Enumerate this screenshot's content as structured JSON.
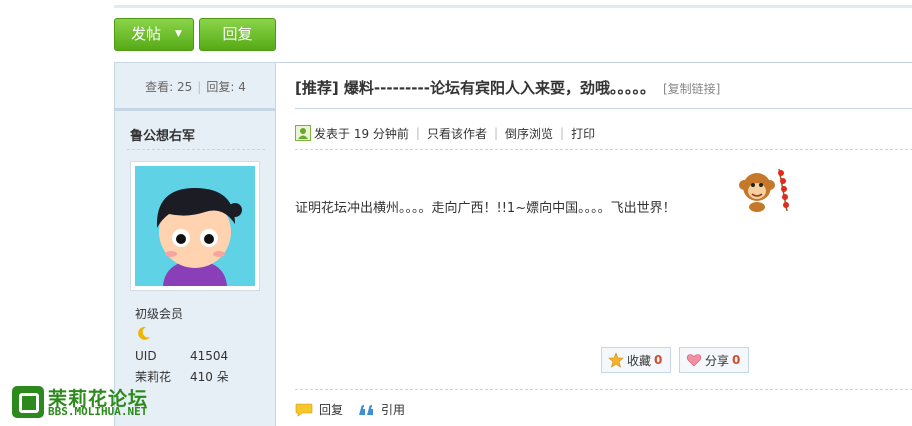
{
  "toolbar": {
    "post_label": "发帖",
    "reply_label": "回复"
  },
  "stats": {
    "views_label": "查看:",
    "views": "25",
    "replies_label": "回复:",
    "replies": "4"
  },
  "author": {
    "name": "鲁公想右军",
    "rank": "初级会员",
    "rows": [
      {
        "key": "UID",
        "value": "41504"
      },
      {
        "key": "茉莉花",
        "value": "410 朵"
      }
    ]
  },
  "thread": {
    "title": "[推荐] 爆料---------论坛有宾阳人入来耍，劲哦。。。。。",
    "copy_link": "[复制链接]"
  },
  "meta": {
    "posted": "发表于 19 分钟前",
    "only_author": "只看该作者",
    "reverse": "倒序浏览",
    "print": "打印"
  },
  "post": {
    "content": "证明花坛冲出横州。。。。走向广西！!!1~嫖向中国。。。。飞出世界！"
  },
  "actions": {
    "favorite_label": "收藏",
    "favorite_count": "0",
    "share_label": "分享",
    "share_count": "0"
  },
  "footer": {
    "reply_label": "回复",
    "quote_label": "引用"
  },
  "logo": {
    "cn": "茉莉花论坛",
    "en": "BBS.MOLIHUA.NET"
  },
  "colors": {
    "accent_green": "#56aa16",
    "border": "#c7d6e5",
    "side_bg": "#e6eef6",
    "count_red": "#d24d2f"
  },
  "icons": [
    "caret-down-icon",
    "moon-icon",
    "user-icon",
    "monkey-emoticon",
    "star-icon",
    "heart-icon",
    "reply-bubble-icon",
    "quote-icon"
  ]
}
